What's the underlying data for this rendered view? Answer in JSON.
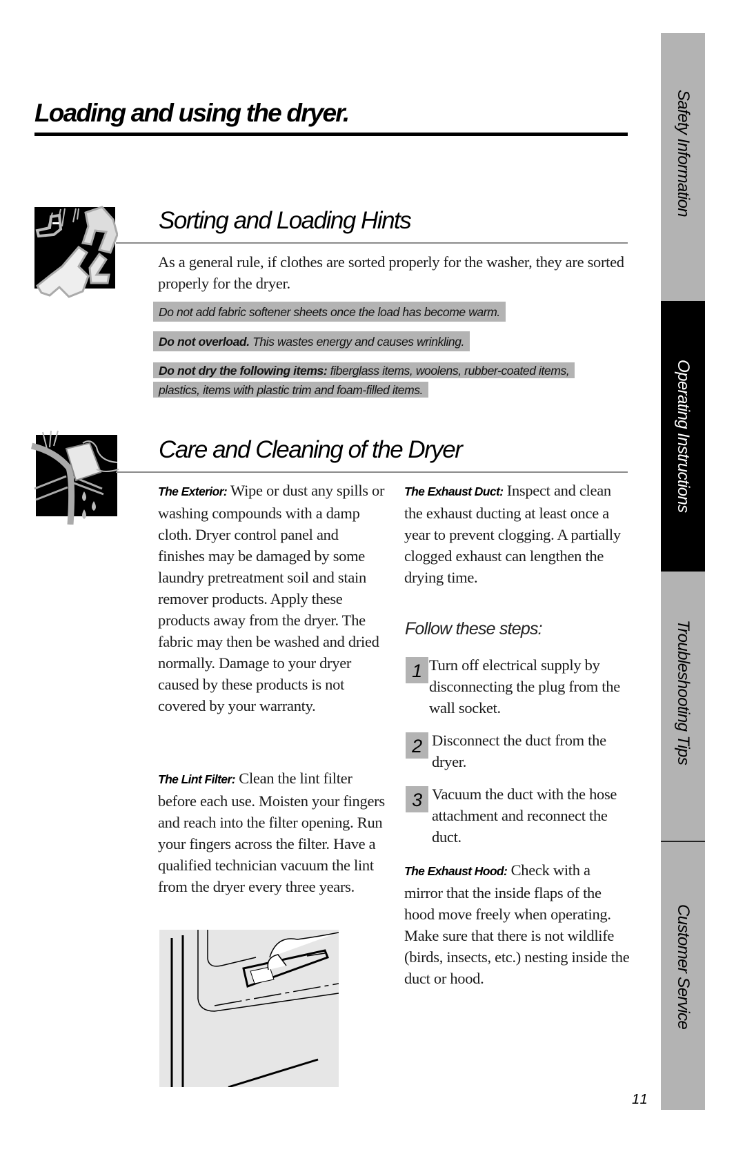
{
  "page": {
    "title": "Loading and using the dryer.",
    "page_number": "11"
  },
  "sorting": {
    "icon": "laundry-clothes-icon",
    "heading": "Sorting and Loading Hints",
    "intro": "As a general rule, if clothes are sorted properly for the washer, they are sorted properly for the dryer.",
    "notes": [
      {
        "bold": "",
        "text": "Do not add fabric softener sheets once the load has become warm."
      },
      {
        "bold": "Do not overload.",
        "text": " This wastes energy and causes wrinkling."
      },
      {
        "bold": "Do not dry the following items:",
        "text": " fiberglass items, woolens, rubber-coated items, plastics, items with plastic trim and foam-filled items."
      }
    ]
  },
  "care": {
    "icon": "sponge-cleaning-icon",
    "heading": "Care and Cleaning of the Dryer",
    "exterior": {
      "label": "The Exterior:",
      "text": " Wipe or dust any spills or washing compounds with a damp cloth. Dryer control panel and finishes may be damaged by some laundry pretreatment soil and stain remover products. Apply these products away from the dryer. The fabric may then be washed and dried normally. Damage to your dryer caused by these products is not covered by your warranty."
    },
    "lint_filter": {
      "label": "The Lint Filter:",
      "text": " Clean the lint filter before each use. Moisten your fingers and reach into the filter opening. Run your fingers across the filter. Have a qualified technician vacuum the lint from the dryer every three years."
    },
    "lint_figure": "lint-filter-illustration",
    "exhaust_duct": {
      "label": "The Exhaust Duct:",
      "text": " Inspect and clean the exhaust ducting at least once a year to prevent clogging. A partially clogged exhaust can lengthen the drying time."
    },
    "follow_steps": "Follow these steps:",
    "steps": [
      {
        "num": "1",
        "text": "Turn off electrical supply by disconnecting the plug from the wall socket."
      },
      {
        "num": "2",
        "text": "Disconnect the duct from the dryer."
      },
      {
        "num": "3",
        "text": "Vacuum the duct with the hose attachment and reconnect the duct."
      }
    ],
    "exhaust_hood": {
      "label": "The Exhaust Hood:",
      "text": " Check with a mirror that the inside flaps of the hood move freely when operating. Make sure that there is not wildlife (birds, insects, etc.) nesting inside the duct or hood."
    }
  },
  "sidebar": {
    "active_tab": "Operating Instructions",
    "tabs": [
      {
        "label": "Safety Information"
      },
      {
        "label": "Operating Instructions"
      },
      {
        "label": "Troubleshooting Tips"
      },
      {
        "label": "Customer Service"
      }
    ],
    "colors": {
      "tab": "#b3b3b3",
      "active_tab": "#000000",
      "active_text": "#ffffff"
    }
  }
}
